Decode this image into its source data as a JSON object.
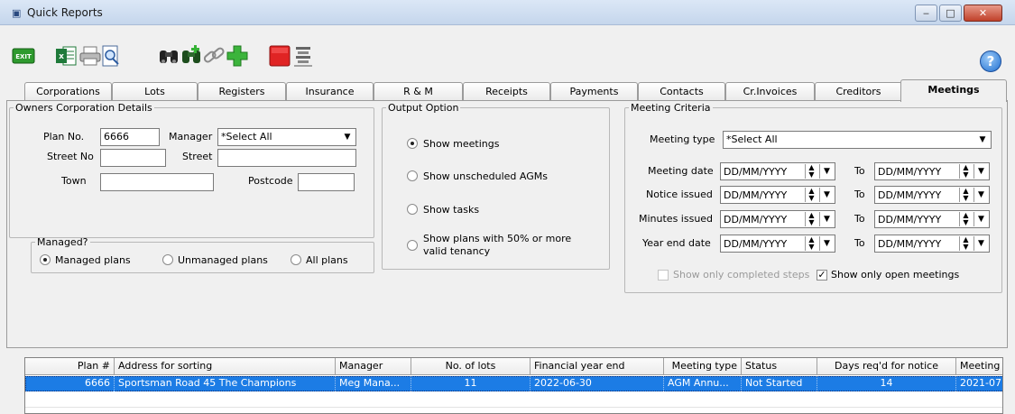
{
  "window": {
    "title": "Quick Reports",
    "min": "‒",
    "max": "□",
    "close": "✕"
  },
  "toolbar": {
    "exit": "EXIT",
    "help": "?",
    "icons": [
      "exit-icon",
      "excel-icon",
      "print-icon",
      "print-preview-icon",
      "binoculars-icon",
      "binoculars-plus-icon",
      "link-icon",
      "add-icon",
      "stop-icon",
      "layout-icon"
    ]
  },
  "tabs": [
    "Corporations",
    "Lots",
    "Registers",
    "Insurance",
    "R & M",
    "Receipts",
    "Payments",
    "Contacts",
    "Cr.Invoices",
    "Creditors",
    "Meetings"
  ],
  "active_tab": "Meetings",
  "owners": {
    "legend": "Owners Corporation Details",
    "plan_label": "Plan No.",
    "plan_value": "6666",
    "manager_label": "Manager",
    "manager_value": "*Select All",
    "street_no_label": "Street No",
    "street_no_value": "",
    "street_label": "Street",
    "street_value": "",
    "town_label": "Town",
    "town_value": "",
    "postcode_label": "Postcode",
    "postcode_value": ""
  },
  "managed": {
    "legend": "Managed?",
    "options": [
      "Managed plans",
      "Unmanaged plans",
      "All plans"
    ],
    "selected": "Managed plans"
  },
  "output": {
    "legend": "Output Option",
    "options": [
      "Show meetings",
      "Show unscheduled AGMs",
      "Show tasks",
      "Show plans with 50% or more",
      "valid tenancy"
    ],
    "selected": "Show meetings"
  },
  "criteria": {
    "legend": "Meeting Criteria",
    "meeting_type_label": "Meeting type",
    "meeting_type_value": "*Select All",
    "date_placeholder": "DD/MM/YYYY",
    "to_label": "To",
    "rows": [
      "Meeting date",
      "Notice issued",
      "Minutes issued",
      "Year end date"
    ],
    "show_completed": "Show only completed steps",
    "show_completed_checked": false,
    "show_open": "Show only open meetings",
    "show_open_checked": true
  },
  "grid": {
    "columns": [
      "Plan #",
      "Address for sorting",
      "Manager",
      "No. of lots",
      "Financial year end",
      "Meeting type",
      "Status",
      "Days req'd for notice",
      "Meeting"
    ],
    "rows": [
      [
        "6666",
        "Sportsman Road 45 The Champions",
        "Meg Mana...",
        "11",
        "2022-06-30",
        "AGM Annu...",
        "Not Started",
        "14",
        "2021-07"
      ]
    ]
  },
  "colors": {
    "selection": "#1c7ce5",
    "titlebar": "#c5d6ec"
  }
}
